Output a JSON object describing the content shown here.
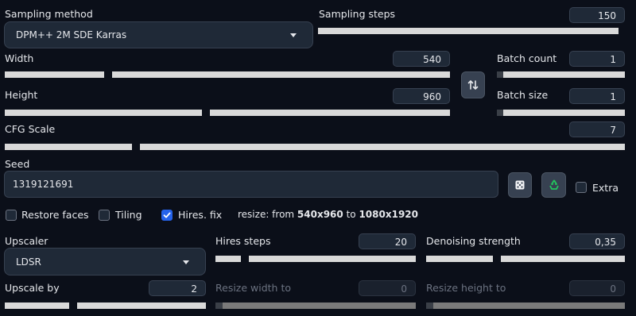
{
  "sampling": {
    "method_label": "Sampling method",
    "method_value": "DPM++ 2M SDE Karras",
    "steps_label": "Sampling steps",
    "steps_value": "150"
  },
  "width": {
    "label": "Width",
    "value": "540"
  },
  "height": {
    "label": "Height",
    "value": "960"
  },
  "batch": {
    "count_label": "Batch count",
    "count_value": "1",
    "size_label": "Batch size",
    "size_value": "1"
  },
  "cfg": {
    "label": "CFG Scale",
    "value": "7"
  },
  "seed": {
    "label": "Seed",
    "value": "1319121691",
    "extra_label": "Extra"
  },
  "options": {
    "restore_faces": {
      "label": "Restore faces",
      "checked": false
    },
    "tiling": {
      "label": "Tiling",
      "checked": false
    },
    "hires_fix": {
      "label": "Hires. fix",
      "checked": true
    },
    "resize_prefix": "resize: from ",
    "resize_from": "540x960",
    "resize_mid": " to ",
    "resize_to": "1080x1920"
  },
  "hires": {
    "upscaler_label": "Upscaler",
    "upscaler_value": "LDSR",
    "steps_label": "Hires steps",
    "steps_value": "20",
    "denoise_label": "Denoising strength",
    "denoise_value": "0,35",
    "upscale_label": "Upscale by",
    "upscale_value": "2",
    "resize_w_label": "Resize width to",
    "resize_w_value": "0",
    "resize_h_label": "Resize height to",
    "resize_h_value": "0"
  },
  "colors": {
    "background": "#0b0f19",
    "panel": "#1f2937",
    "accent": "#2563eb",
    "slider_track": "#d9d9d9"
  },
  "icons": {
    "swap": "swap-dimensions-icon",
    "dice": "dice-icon",
    "recycle": "recycle-icon",
    "check": "checkmark-icon",
    "caret": "chevron-down-icon"
  }
}
